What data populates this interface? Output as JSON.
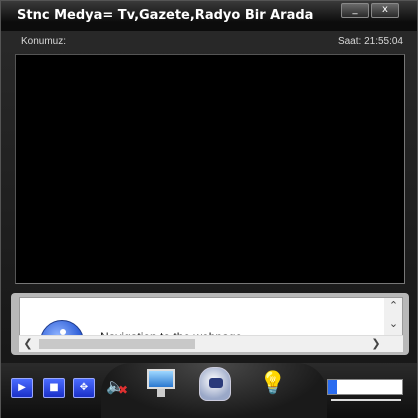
{
  "window": {
    "title": "Stnc Medya= Tv,Gazete,Radyo Bir Arada",
    "minimize_label": "_",
    "close_label": "x"
  },
  "status": {
    "location_label": "Konumuz:",
    "time_label": "Saat: 21:55:04"
  },
  "info_panel": {
    "text": "Navigation to the webpage..."
  },
  "controls": {
    "play_label": "▶",
    "stop_label": "■",
    "fullscreen_label": "✥",
    "mute_icon": "speaker-mute-icon",
    "tv_icon": "tv-icon",
    "radio_icon": "radio-icon",
    "newspaper_icon": "lightbulb-icon",
    "volume_level": 0.12
  },
  "colors": {
    "accent_blue": "#2a6cf0",
    "button_blue": "#1a30c8",
    "bulb_green": "#6cff4a"
  }
}
